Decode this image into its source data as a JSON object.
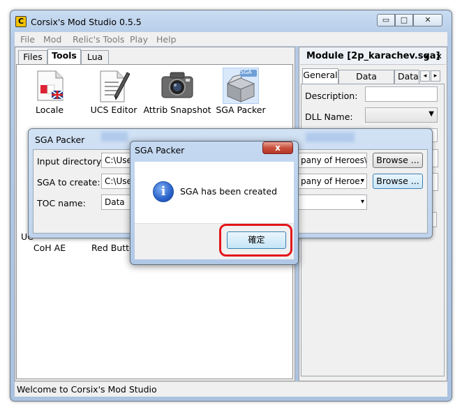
{
  "window": {
    "title": "Corsix's Mod Studio 0.5.5",
    "controls": [
      "▭",
      "□",
      "✕"
    ]
  },
  "menu": [
    "File",
    "Mod",
    "Relic's Tools",
    "Play",
    "Help"
  ],
  "left_tabs": [
    "Files",
    "Tools",
    "Lua"
  ],
  "tools_row1": [
    "Locale",
    "UCS Editor",
    "Attrib Snapshot",
    "SGA Packer"
  ],
  "tools_row2_partial": [
    "UC",
    "CoH AE",
    "Red Butto"
  ],
  "sga_icon_text": "SGA",
  "right_panel": {
    "title": "Module [2p_karachev.sga]",
    "title_controls": [
      "▾",
      "✕"
    ],
    "tabs": [
      "General",
      "Data Folders",
      "Data"
    ],
    "tab_scroll": [
      "◂",
      "▸"
    ],
    "fields": [
      "Description:",
      "DLL Name:"
    ]
  },
  "status": "Welcome to Corsix's Mod Studio",
  "sga_dialog": {
    "title": "SGA Packer",
    "labels": [
      "Input directory:",
      "SGA to create:",
      "TOC name:"
    ],
    "values": [
      "C:\\Use",
      "C:\\Use",
      "Data"
    ],
    "right_values": [
      "pany of Heroes\\W",
      "pany of Heroe:"
    ],
    "browse_label": "Browse ...",
    "dropdown_arrow": "▾"
  },
  "message_box": {
    "title": "SGA Packer",
    "close_glyph": "x",
    "info_glyph": "i",
    "message": "SGA has been created",
    "ok_label": "確定"
  }
}
